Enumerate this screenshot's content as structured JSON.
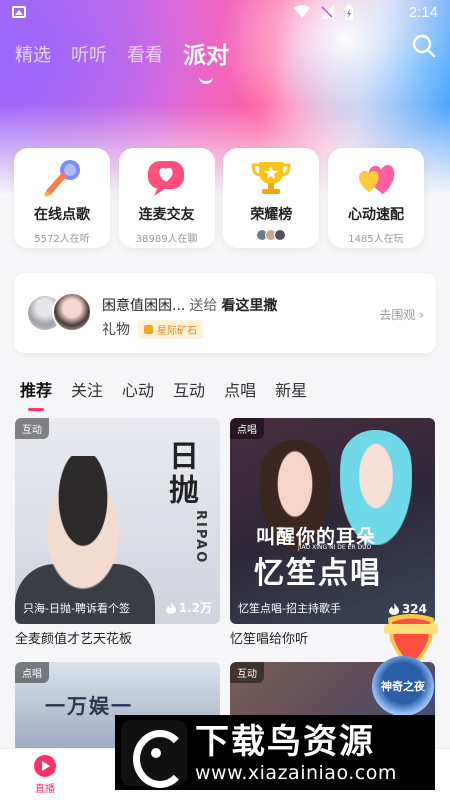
{
  "status_bar": {
    "time": "2:14"
  },
  "top_nav": {
    "tabs": [
      {
        "label": "精选"
      },
      {
        "label": "听听"
      },
      {
        "label": "看看"
      },
      {
        "label": "派对"
      }
    ],
    "active_tab": "派对"
  },
  "features": [
    {
      "title": "在线点歌",
      "subtitle": "5572人在听",
      "icon": "microphone-icon"
    },
    {
      "title": "连麦交友",
      "subtitle": "38989人在聊",
      "icon": "heart-chat-icon"
    },
    {
      "title": "荣耀榜",
      "subtitle": "",
      "icon": "trophy-icon"
    },
    {
      "title": "心动速配",
      "subtitle": "1485人在玩",
      "icon": "double-heart-icon"
    }
  ],
  "gift_banner": {
    "sender": "困意值困困...",
    "action": "送给",
    "receiver": "看这里撒",
    "item": "礼物",
    "badge": "星际矿石",
    "link": "去围观"
  },
  "sub_tabs": [
    "推荐",
    "关注",
    "心动",
    "互动",
    "点唱",
    "新星"
  ],
  "cards": [
    {
      "tag": "互动",
      "caption": "只海-日抛-聘诉看个签",
      "count": "1.2万",
      "title": "全麦颜值才艺天花板",
      "poster_big": "日抛",
      "poster_latin": "RIPAO"
    },
    {
      "tag": "点唱",
      "caption": "忆笙点唱-招主持歌手",
      "count": "324",
      "title": "忆笙唱给你听",
      "poster_line1": "叫醒你的耳朵",
      "poster_line2": "忆笙点唱",
      "poster_pinyin": "JIAO XING NI DE ER DUO"
    },
    {
      "tag": "点唱",
      "poster_text": "一万娱一"
    },
    {
      "tag": "互动"
    }
  ],
  "floating": {
    "badge_text": "神奇之夜"
  },
  "bottom_nav": [
    {
      "label": "直播"
    }
  ],
  "watermark": {
    "title": "下载鸟资源",
    "url": "www.xiazainiao.com"
  },
  "colors": {
    "accent": "#ff2f6a",
    "tab_indicator": "#ff3b6b"
  }
}
